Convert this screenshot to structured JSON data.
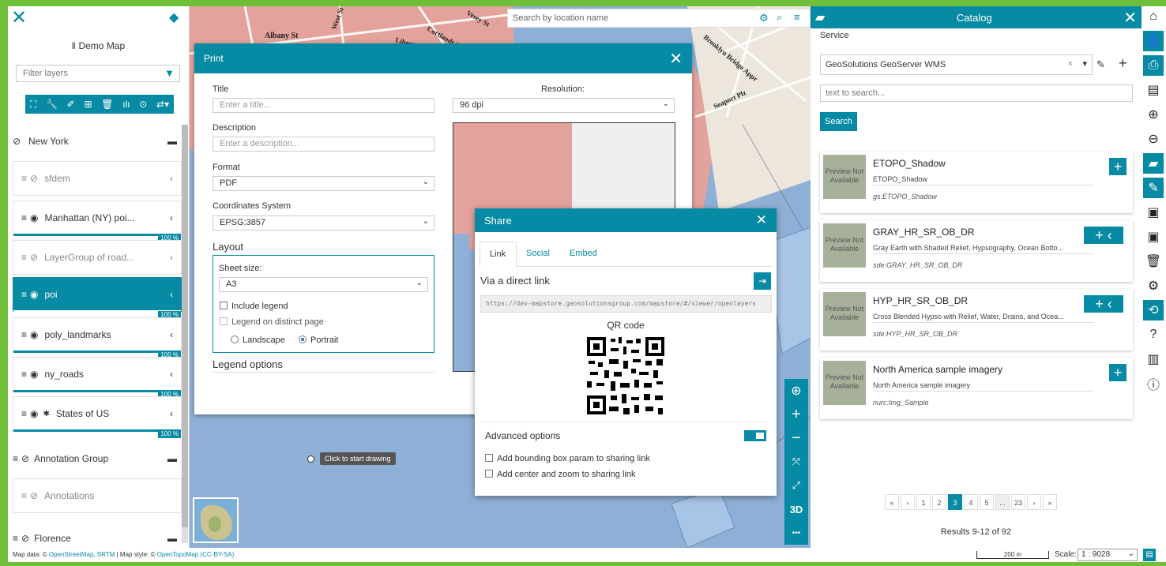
{
  "toc": {
    "title": "Demo Map",
    "filter_placeholder": "Filter layers",
    "layers": [
      {
        "label": "New York",
        "kind": "group"
      },
      {
        "label": "sfdem",
        "kind": "layer"
      },
      {
        "label": "Manhattan (NY) poi...",
        "kind": "layer",
        "opacity": "100 %"
      },
      {
        "label": "LayerGroup of road...",
        "kind": "layer"
      },
      {
        "label": "poi",
        "kind": "layer",
        "opacity": "100 %"
      },
      {
        "label": "poly_landmarks",
        "kind": "layer",
        "opacity": "100 %"
      },
      {
        "label": "ny_roads",
        "kind": "layer",
        "opacity": "100 %"
      },
      {
        "label": "States of US",
        "kind": "layer",
        "opacity": "100 %"
      },
      {
        "label": "Annotation Group",
        "kind": "group"
      },
      {
        "label": "Annotations",
        "kind": "layer"
      },
      {
        "label": "Florence",
        "kind": "group"
      }
    ]
  },
  "map": {
    "search_placeholder": "Search by location name",
    "streets": [
      "Albany St",
      "West St",
      "Liberty St",
      "Cortlandt St",
      "Vesey St",
      "Brooklyn Bridge Appr",
      "Seaport Plz"
    ],
    "draw_tooltip": "Click to start drawing",
    "controls": [
      "locate",
      "zoom-in",
      "zoom-out",
      "full-extent",
      "fullscreen",
      "3D",
      "more"
    ],
    "btn_3d": "3D",
    "btn_more": "•••",
    "scale_bar": "200 m",
    "scale_label": "Scale:",
    "scale_value": "1 : 9028"
  },
  "print": {
    "title": "Print",
    "title_label": "Title",
    "title_placeholder": "Enter a title...",
    "description_label": "Description",
    "description_placeholder": "Enter a description...",
    "format_label": "Format",
    "format_value": "PDF",
    "crs_label": "Coordinates System",
    "crs_value": "EPSG:3857",
    "layout_label": "Layout",
    "sheet_label": "Sheet size:",
    "sheet_value": "A3",
    "include_legend": "Include legend",
    "legend_distinct": "Legend on distinct page",
    "landscape": "Landscape",
    "portrait": "Portrait",
    "legend_options": "Legend options",
    "resolution_label": "Resolution:",
    "resolution_value": "96 dpi"
  },
  "share": {
    "title": "Share",
    "tabs": [
      "Link",
      "Social",
      "Embed"
    ],
    "direct_link_label": "Via a direct link",
    "link": "https://dev-mapstore.geosolutionsgroup.com/mapstore/#/viewer/openlayers",
    "qr_label": "QR code",
    "advanced_label": "Advanced options",
    "opt_bbox": "Add bounding box param to sharing link",
    "opt_center": "Add center and zoom to sharing link"
  },
  "catalog": {
    "title": "Catalog",
    "service_label": "Service",
    "service_value": "GeoSolutions GeoServer WMS",
    "search_placeholder": "text to search...",
    "search_button": "Search",
    "preview_text": "Preview Not Available",
    "records": [
      {
        "title": "ETOPO_Shadow",
        "desc": "ETOPO_Shadow",
        "name": "gs:ETOPO_Shadow"
      },
      {
        "title": "GRAY_HR_SR_OB_DR",
        "desc": "Gray Earth with Shaded Relief, Hypsography, Ocean Botto...",
        "name": "sde:GRAY_HR_SR_OB_DR"
      },
      {
        "title": "HYP_HR_SR_OB_DR",
        "desc": "Cross Blended Hypso with Relief, Water, Drains, and Ocea...",
        "name": "sde:HYP_HR_SR_OB_DR"
      },
      {
        "title": "North America sample imagery",
        "desc": "North America sample imagery",
        "name": "nurc:Img_Sample"
      }
    ],
    "pages": [
      "«",
      "‹",
      "1",
      "2",
      "3",
      "4",
      "5",
      "...",
      "23",
      "›",
      "»"
    ],
    "current_page": "3",
    "results": "Results 9-12 of 92"
  },
  "footer": {
    "prefix": "Map data: © ",
    "osm": "OpenStreetMap",
    "sep1": ", ",
    "srtm": "SRTM",
    "mid": " | Map style: © ",
    "otm": "OpenTopoMap",
    "sp": " ",
    "cc": "(CC-BY-SA)"
  },
  "colors": {
    "accent": "#078aa3",
    "frame": "#6fbf3a",
    "land": "#e7a8a0",
    "water": "#8fb0d6"
  }
}
